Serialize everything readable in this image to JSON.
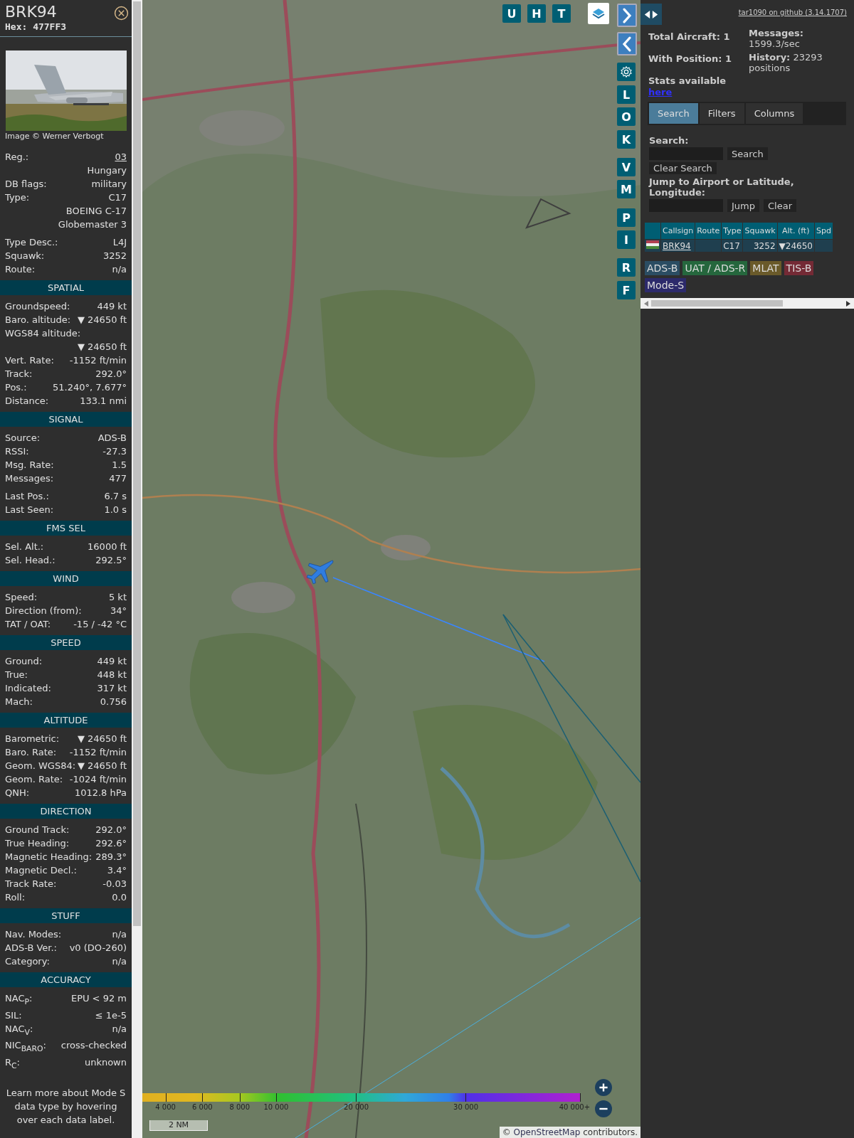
{
  "aircraft": {
    "callsign": "BRK94",
    "hex": "Hex: 477FF3",
    "photo_credit": "Image © Werner Verbogt"
  },
  "info_groups": [
    [
      {
        "label": "Reg.:",
        "value": "03",
        "kind": "link"
      },
      {
        "value": "Hungary"
      },
      {
        "label": "DB flags:",
        "value": "military"
      },
      {
        "label": "Type:",
        "value": "C17"
      },
      {
        "value": "BOEING C-17 Globemaster 3"
      }
    ],
    [
      {
        "label": "Type Desc.:",
        "value": "L4J"
      },
      {
        "label": "Squawk:",
        "value": "3252"
      },
      {
        "label": "Route:",
        "value": "n/a"
      }
    ]
  ],
  "sections": [
    {
      "title": "SPATIAL",
      "groups": [
        [
          {
            "label": "Groundspeed:",
            "value": "449 kt"
          },
          {
            "label": "Baro. altitude:",
            "value": "▼ 24650 ft"
          },
          {
            "label": "WGS84 altitude:"
          },
          {
            "value": "▼ 24650 ft"
          },
          {
            "label": "Vert. Rate:",
            "value": "-1152 ft/min"
          },
          {
            "label": "Track:",
            "value": "292.0°"
          },
          {
            "label": "Pos.:",
            "value": "51.240°, 7.677°"
          },
          {
            "label": "Distance:",
            "value": "133.1 nmi"
          }
        ]
      ]
    },
    {
      "title": "SIGNAL",
      "groups": [
        [
          {
            "label": "Source:",
            "value": "ADS-B"
          },
          {
            "label": "RSSI:",
            "value": "-27.3"
          },
          {
            "label": "Msg. Rate:",
            "value": "1.5"
          },
          {
            "label": "Messages:",
            "value": "477"
          }
        ],
        [
          {
            "label": "Last Pos.:",
            "value": "6.7 s"
          },
          {
            "label": "Last Seen:",
            "value": "1.0 s"
          }
        ]
      ]
    },
    {
      "title": "FMS SEL",
      "groups": [
        [
          {
            "label": "Sel. Alt.:",
            "value": "16000 ft"
          },
          {
            "label": "Sel. Head.:",
            "value": "292.5°"
          }
        ]
      ]
    },
    {
      "title": "WIND",
      "groups": [
        [
          {
            "label": "Speed:",
            "value": "5 kt"
          },
          {
            "label": "Direction (from):",
            "value": "34°"
          },
          {
            "label": "TAT / OAT:",
            "value": "-15 / -42 °C"
          }
        ]
      ]
    },
    {
      "title": "SPEED",
      "groups": [
        [
          {
            "label": "Ground:",
            "value": "449 kt"
          },
          {
            "label": "True:",
            "value": "448 kt"
          },
          {
            "label": "Indicated:",
            "value": "317 kt"
          },
          {
            "label": "Mach:",
            "value": "0.756"
          }
        ]
      ]
    },
    {
      "title": "ALTITUDE",
      "groups": [
        [
          {
            "label": "Barometric:",
            "value": "▼ 24650 ft"
          },
          {
            "label": "Baro. Rate:",
            "value": "-1152 ft/min"
          },
          {
            "label": "Geom. WGS84:",
            "value": "▼ 24650 ft"
          },
          {
            "label": "Geom. Rate:",
            "value": "-1024 ft/min"
          },
          {
            "label": "QNH:",
            "value": "1012.8 hPa"
          }
        ]
      ]
    },
    {
      "title": "DIRECTION",
      "groups": [
        [
          {
            "label": "Ground Track:",
            "value": "292.0°"
          },
          {
            "label": "True Heading:",
            "value": "292.6°"
          },
          {
            "label": "Magnetic Heading:",
            "value": "289.3°"
          },
          {
            "label": "Magnetic Decl.:",
            "value": "3.4°"
          },
          {
            "label": "Track Rate:",
            "value": "-0.03"
          },
          {
            "label": "Roll:",
            "value": "0.0"
          }
        ]
      ]
    },
    {
      "title": "STUFF",
      "groups": [
        [
          {
            "label": "Nav. Modes:",
            "value": "n/a"
          },
          {
            "label": "ADS-B Ver.:",
            "value": "v0 (DO-260)"
          },
          {
            "label": "Category:",
            "value": "n/a"
          }
        ]
      ]
    },
    {
      "title": "ACCURACY",
      "groups": [
        [
          {
            "label": "NAC$_{P}$:",
            "value": "EPU < 92 m"
          },
          {
            "label": "SIL:",
            "value": "≤ 1e-5"
          },
          {
            "label": "NAC$_{V}$:",
            "value": "n/a"
          },
          {
            "label": "NIC$_{BARO}$:",
            "value": "cross-checked"
          },
          {
            "label": "R$_{C}$:",
            "value": "unknown"
          }
        ]
      ]
    }
  ],
  "footer_note": "Learn more about Mode S data type by hovering over each data label.",
  "map": {
    "top_buttons": [
      "U",
      "H",
      "T"
    ],
    "side_buttons": [
      {
        "kind": "next"
      },
      {
        "kind": "prev"
      },
      {
        "kind": "settings"
      },
      {
        "kind": "letter",
        "label": "L"
      },
      {
        "kind": "letter",
        "label": "O"
      },
      {
        "kind": "letter",
        "label": "K"
      },
      {
        "kind": "letter",
        "label": "V"
      },
      {
        "kind": "letter",
        "label": "M"
      },
      {
        "kind": "letter",
        "label": "P"
      },
      {
        "kind": "letter",
        "label": "I"
      },
      {
        "kind": "letter",
        "label": "R"
      },
      {
        "kind": "letter",
        "label": "F"
      }
    ],
    "altitude_scale": [
      "4 000",
      "6 000",
      "8 000",
      "10 000",
      "20 000",
      "30 000",
      "40 000+"
    ],
    "scale_bar": "2 NM",
    "attribution_prefix": "©",
    "attribution_link": "OpenStreetMap",
    "attribution_suffix": "contributors."
  },
  "panel": {
    "github_link": "tar1090 on github (3.14.1707)",
    "total_aircraft": "Total Aircraft: 1",
    "with_position": "With Position: 1",
    "stats_text": "Stats available",
    "stats_link": "here",
    "messages": "**Messages:** 1599.3/sec",
    "history": "**History:** 23293 positions",
    "tabs": [
      {
        "label": "Search",
        "selected": true
      },
      {
        "label": "Filters",
        "selected": false
      },
      {
        "label": "Columns",
        "selected": false
      }
    ],
    "search_label": "Search:",
    "search_button": "Search",
    "clear_search_button": "Clear Search",
    "jump_label": "Jump to Airport or Latitude, Longitude:",
    "jump_button": "Jump",
    "clear_button": "Clear",
    "table": {
      "columns": [
        "Callsign",
        "Route",
        "Type",
        "Squawk",
        "Alt. (ft)",
        "Spd"
      ],
      "rows": [
        {
          "cells": [
            "BRK94",
            null,
            "C17",
            "3252",
            "▼24650",
            null
          ]
        }
      ]
    },
    "legend": [
      {
        "label": "ADS-B",
        "color": "#2b4d63"
      },
      {
        "label": "UAT / ADS-R",
        "color": "#25673d"
      },
      {
        "label": "MLAT",
        "color": "#6a5a2a"
      },
      {
        "label": "TIS-B",
        "color": "#742a35"
      },
      {
        "label": "Mode-S",
        "color": "#2c2a6b"
      }
    ]
  }
}
